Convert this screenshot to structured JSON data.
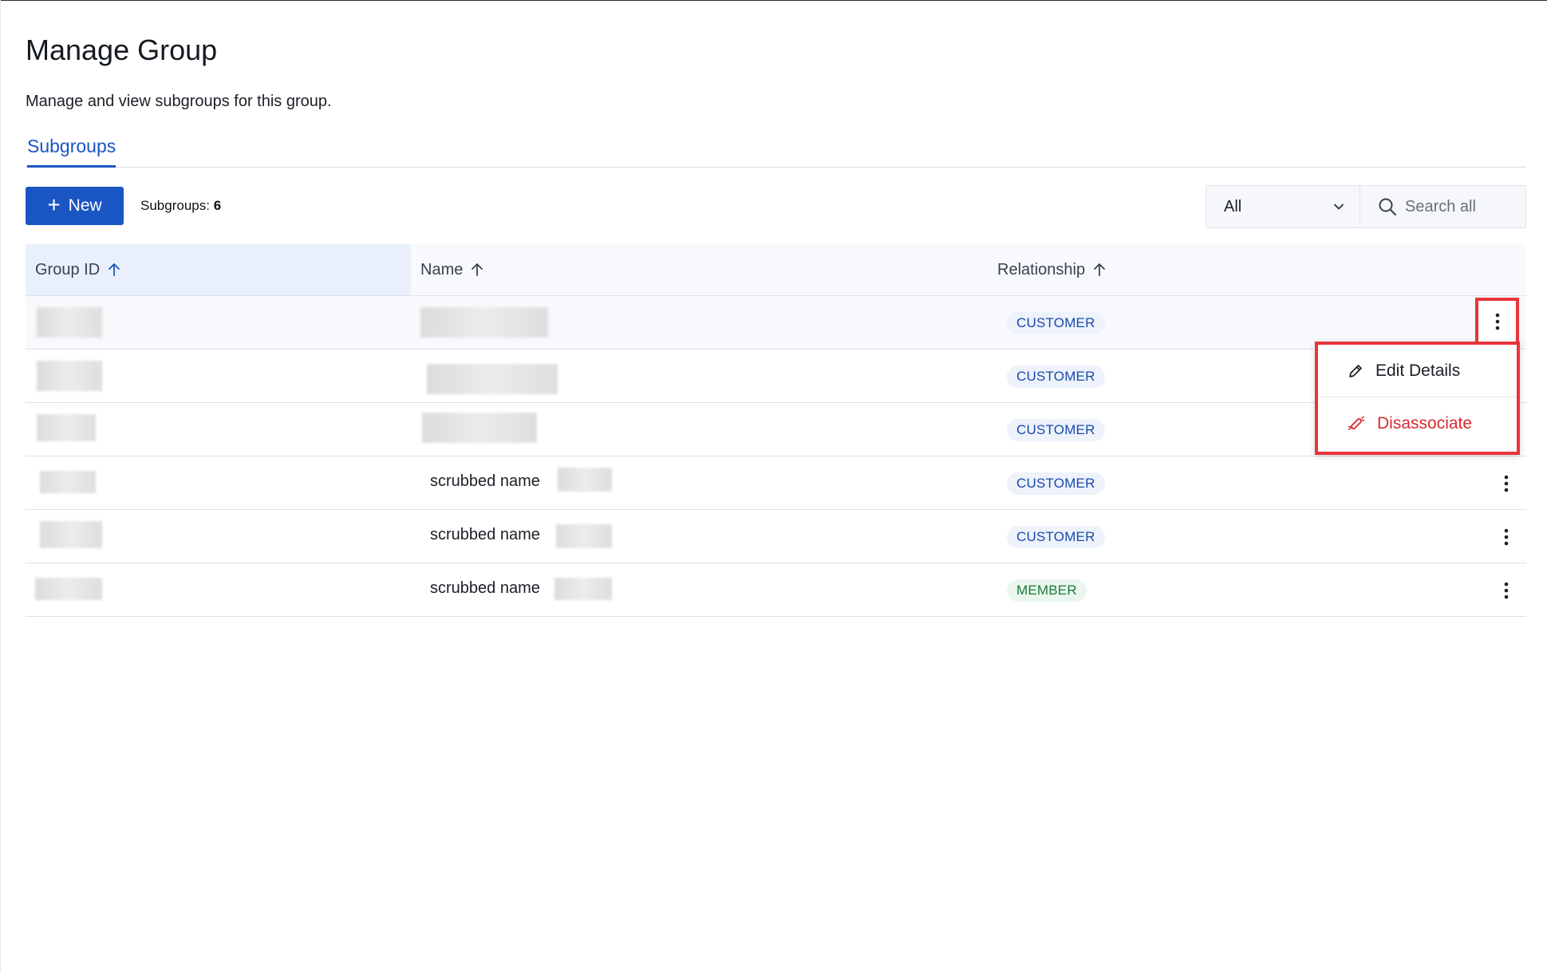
{
  "page": {
    "title": "Manage Group",
    "subtitle": "Manage and view subgroups for this group."
  },
  "tabs": [
    {
      "label": "Subgroups",
      "active": true
    }
  ],
  "toolbar": {
    "new_label": "New",
    "count_label": "Subgroups:",
    "count_value": "6",
    "filter_value": "All",
    "search_placeholder": "Search all"
  },
  "table": {
    "columns": [
      {
        "label": "Group ID",
        "sort": "asc"
      },
      {
        "label": "Name",
        "sort": "asc"
      },
      {
        "label": "Relationship",
        "sort": "asc"
      }
    ],
    "rows": [
      {
        "name": "",
        "relationship": "CUSTOMER"
      },
      {
        "name": "",
        "relationship": "CUSTOMER"
      },
      {
        "name": "",
        "relationship": "CUSTOMER"
      },
      {
        "name": "scrubbed name",
        "relationship": "CUSTOMER"
      },
      {
        "name": "scrubbed name",
        "relationship": "CUSTOMER"
      },
      {
        "name": "scrubbed name",
        "relationship": "MEMBER"
      }
    ]
  },
  "row_menu": {
    "items": [
      {
        "label": "Edit Details",
        "icon": "pencil-icon"
      },
      {
        "label": "Disassociate",
        "icon": "unlink-icon"
      }
    ]
  },
  "colors": {
    "accent": "#1a55c4",
    "danger": "#d42a2f",
    "highlight": "#e9343b",
    "customer_badge": "#1a4aa8",
    "member_badge": "#1c7a38"
  }
}
